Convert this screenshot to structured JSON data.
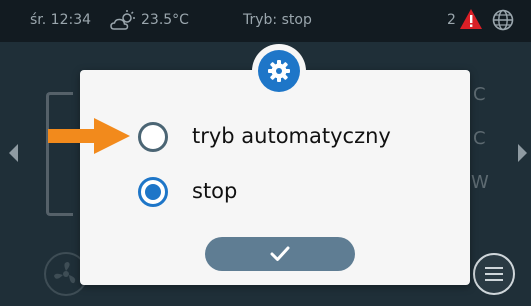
{
  "statusbar": {
    "time": "śr. 12:34",
    "weather_icon": "partly-cloudy-icon",
    "temperature": "23.5°C",
    "mode": "Tryb: stop",
    "alarm_count": "2",
    "alarm_icon": "warning-icon",
    "language_icon": "globe-icon"
  },
  "background": {
    "right_labels": [
      "C",
      "C",
      "W"
    ]
  },
  "dialog": {
    "header_icon": "gear-icon",
    "options": [
      {
        "label": "tryb automatyczny",
        "selected": false
      },
      {
        "label": "stop",
        "selected": true
      }
    ],
    "confirm_icon": "check-icon"
  },
  "annotation": {
    "arrow_color": "#f28a1c"
  },
  "colors": {
    "accent": "#1e76c8",
    "dialog_bg": "#f6f6f6",
    "button": "#5f7d93"
  }
}
